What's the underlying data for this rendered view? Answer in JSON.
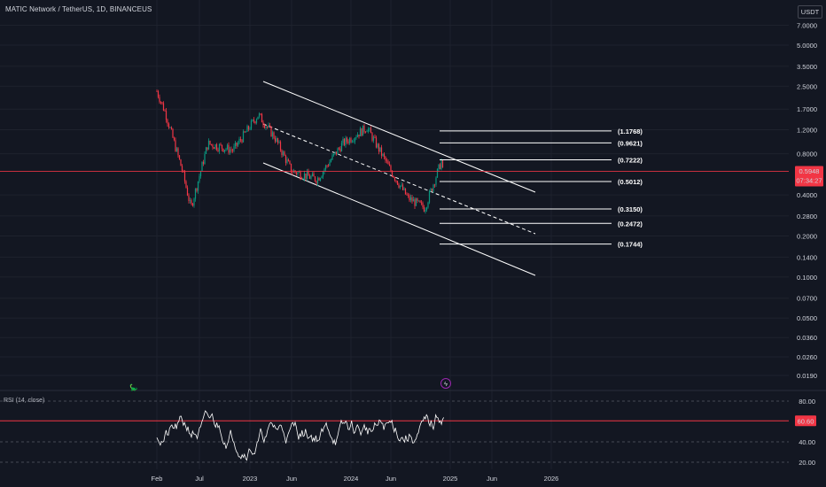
{
  "header": {
    "title": "MATIC Network / TetherUS, 1D, BINANCEUS",
    "currency": "USDT"
  },
  "chart_data": [
    {
      "type": "line",
      "title": "MATIC Network / TetherUS, 1D, BINANCEUS",
      "price_axis": [
        "7.0000",
        "5.0000",
        "3.5000",
        "2.5000",
        "1.7000",
        "1.2000",
        "0.8000",
        "0.5948",
        "0.4000",
        "0.2800",
        "0.2000",
        "0.1400",
        "0.1000",
        "0.0700",
        "0.0500",
        "0.0360",
        "0.0260",
        "0.0190"
      ],
      "current_price": "0.5948",
      "countdown": "07:34:27",
      "time_axis": [
        "Feb",
        "Jul",
        "2023",
        "Jun",
        "2024",
        "Jun",
        "2025",
        "Jun",
        "2026"
      ],
      "fib_levels": [
        "(1.1768)",
        "(0.9621)",
        "(0.7222)",
        "(0.5012)",
        "(0.3150)",
        "(0.2472)",
        "(0.1744)"
      ],
      "price_key_points": [
        {
          "date": "2022-02",
          "price": 2.3
        },
        {
          "date": "2022-03",
          "price": 1.6
        },
        {
          "date": "2022-05",
          "price": 0.6
        },
        {
          "date": "2022-06",
          "price": 0.32
        },
        {
          "date": "2022-08",
          "price": 0.95
        },
        {
          "date": "2022-11",
          "price": 0.85
        },
        {
          "date": "2023-02",
          "price": 1.55
        },
        {
          "date": "2023-04",
          "price": 1.05
        },
        {
          "date": "2023-06",
          "price": 0.6
        },
        {
          "date": "2023-09",
          "price": 0.52
        },
        {
          "date": "2023-12",
          "price": 0.95
        },
        {
          "date": "2024-03",
          "price": 1.25
        },
        {
          "date": "2024-06",
          "price": 0.6
        },
        {
          "date": "2024-08",
          "price": 0.38
        },
        {
          "date": "2024-10",
          "price": 0.32
        },
        {
          "date": "2024-12",
          "price": 0.72
        },
        {
          "date": "2024-12",
          "price": 0.5948
        }
      ]
    },
    {
      "type": "line",
      "title": "RSI (14, close)",
      "y_axis": [
        "80.00",
        "60.60",
        "40.00",
        "20.00"
      ],
      "current_value": "60.60"
    }
  ],
  "colors": {
    "background": "#131722",
    "grid": "#1e222d",
    "price_line": "#f23645",
    "up": "#089981",
    "down": "#f23645",
    "channel": "#ffffff",
    "rsi_line": "#ffffff",
    "event_icon": "#9c27b0"
  }
}
